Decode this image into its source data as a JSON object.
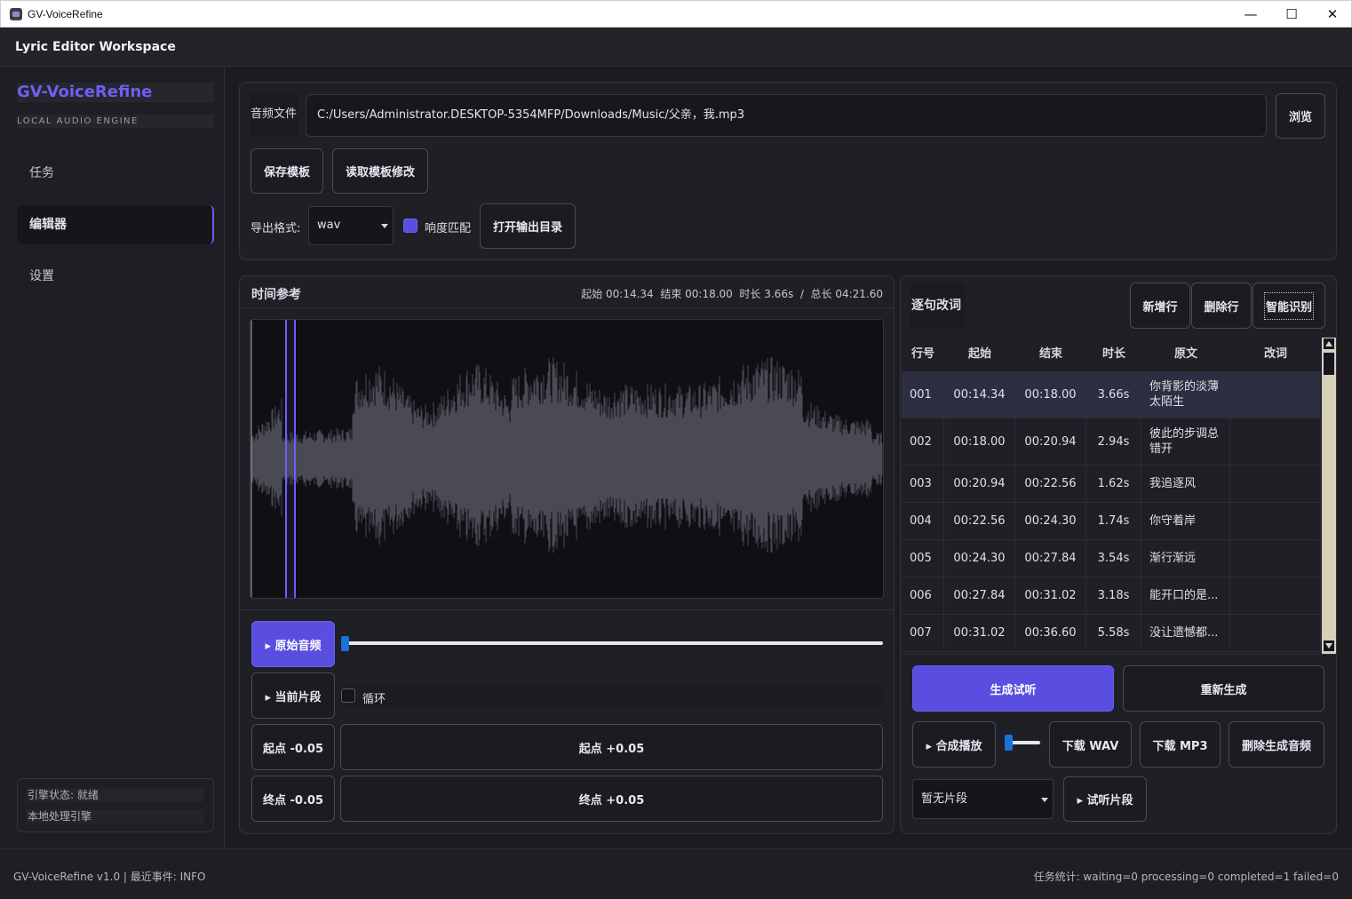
{
  "window": {
    "title": "GV-VoiceRefine",
    "minimize": "—",
    "maximize": "☐",
    "close": "✕"
  },
  "workspace": {
    "title": "Lyric Editor Workspace"
  },
  "sidebar": {
    "brand": "GV-VoiceRefine",
    "brand_sub": "LOCAL AUDIO ENGINE",
    "items": [
      {
        "label": "任务"
      },
      {
        "label": "编辑器"
      },
      {
        "label": "设置"
      }
    ],
    "active_index": 1,
    "status": {
      "engine_state": "引擎状态: 就绪",
      "engine_name": "本地处理引擎"
    }
  },
  "file_section": {
    "audio_label": "音频文件",
    "audio_path": "C:/Users/Administrator.DESKTOP-5354MFP/Downloads/Music/父亲，我.mp3",
    "browse_label": "浏览",
    "save_template_label": "保存模板",
    "load_template_label": "读取模板修改",
    "export_format_label": "导出格式:",
    "export_format_value": "wav",
    "loudness_match_label": "响度匹配",
    "loudness_match_checked": true,
    "open_output_dir_label": "打开输出目录"
  },
  "time_reference": {
    "title": "时间参考",
    "info": "起始 00:14.34  结束 00:18.00  时长 3.66s  /  总长 04:21.60",
    "playhead_fraction": 0.055,
    "original_audio_label": "▸ 原始音频",
    "current_segment_label": "▸ 当前片段",
    "loop_label": "循环",
    "loop_checked": false,
    "start_minus_label": "起点 -0.05",
    "start_plus_label": "起点 +0.05",
    "end_minus_label": "终点 -0.05",
    "end_plus_label": "终点 +0.05",
    "playback_position": 0.0
  },
  "lyrics": {
    "title": "逐句改词",
    "new_row_label": "新增行",
    "delete_row_label": "删除行",
    "smart_detect_label": "智能识别",
    "columns": [
      "行号",
      "起始",
      "结束",
      "时长",
      "原文",
      "改词"
    ],
    "rows": [
      {
        "no": "001",
        "start": "00:14.34",
        "end": "00:18.00",
        "dur": "3.66s",
        "orig": "你背影的淡薄\n太陌生",
        "edit": ""
      },
      {
        "no": "002",
        "start": "00:18.00",
        "end": "00:20.94",
        "dur": "2.94s",
        "orig": "彼此的步调总\n错开",
        "edit": ""
      },
      {
        "no": "003",
        "start": "00:20.94",
        "end": "00:22.56",
        "dur": "1.62s",
        "orig": "我追逐风",
        "edit": ""
      },
      {
        "no": "004",
        "start": "00:22.56",
        "end": "00:24.30",
        "dur": "1.74s",
        "orig": "你守着岸",
        "edit": ""
      },
      {
        "no": "005",
        "start": "00:24.30",
        "end": "00:27.84",
        "dur": "3.54s",
        "orig": "渐行渐远",
        "edit": ""
      },
      {
        "no": "006",
        "start": "00:27.84",
        "end": "00:31.02",
        "dur": "3.18s",
        "orig": "能开口的是...",
        "edit": ""
      },
      {
        "no": "007",
        "start": "00:31.02",
        "end": "00:36.60",
        "dur": "5.58s",
        "orig": "没让遗憾都...",
        "edit": ""
      }
    ],
    "generate_preview_label": "生成试听",
    "regenerate_label": "重新生成",
    "synth_play_label": "▸ 合成播放",
    "download_wav_label": "下载 WAV",
    "download_mp3_label": "下载 MP3",
    "delete_generated_label": "删除生成音频",
    "segment_select_value": "暂无片段",
    "preview_segment_label": "▸ 试听片段"
  },
  "bottom": {
    "left": "GV-VoiceRefine v1.0 | 最近事件: INFO",
    "right": "任务统计: waiting=0 processing=0 completed=1 failed=0"
  },
  "colors": {
    "accent": "#5a4ee0",
    "brand": "#6f5ff0",
    "slider_handle": "#1a72d6",
    "waveform": "#4a4a54"
  },
  "icons": {
    "app": "app-icon",
    "dropdown": "chevron-down-icon",
    "scroll_up": "arrow-up-icon",
    "scroll_down": "arrow-down-icon"
  }
}
